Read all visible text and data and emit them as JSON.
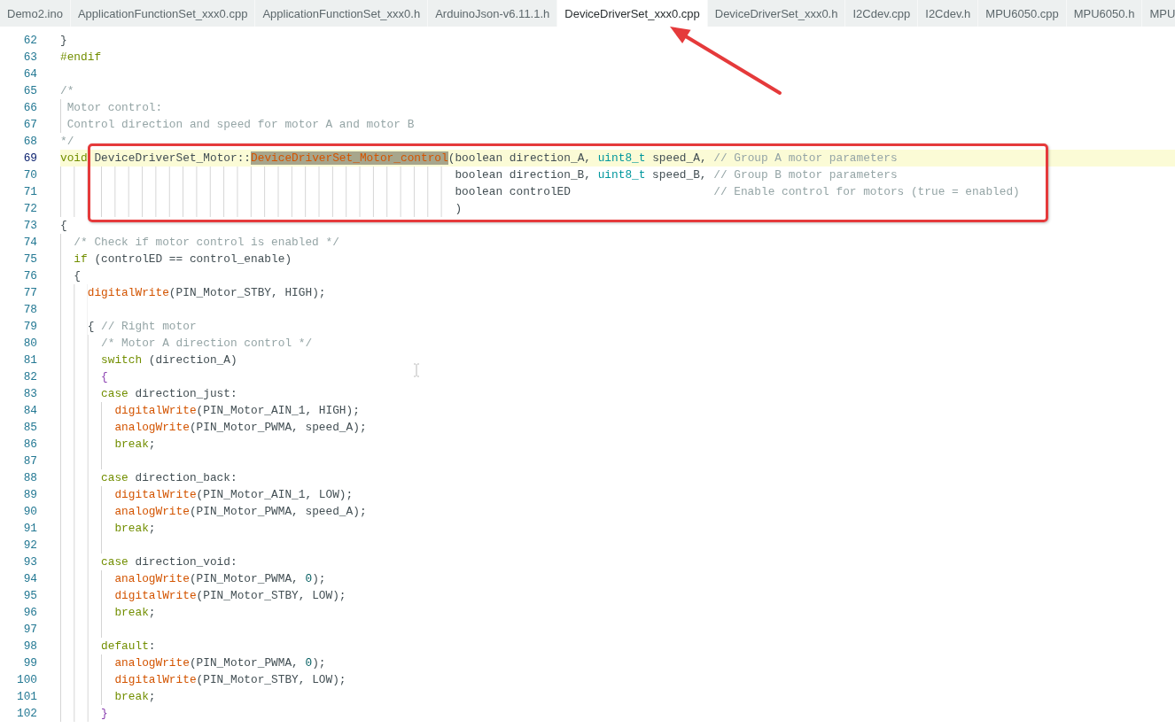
{
  "tabs": [
    {
      "label": "Demo2.ino",
      "selected": false
    },
    {
      "label": "ApplicationFunctionSet_xxx0.cpp",
      "selected": false
    },
    {
      "label": "ApplicationFunctionSet_xxx0.h",
      "selected": false
    },
    {
      "label": "ArduinoJson-v6.11.1.h",
      "selected": false
    },
    {
      "label": "DeviceDriverSet_xxx0.cpp",
      "selected": true
    },
    {
      "label": "DeviceDriverSet_xxx0.h",
      "selected": false
    },
    {
      "label": "I2Cdev.cpp",
      "selected": false
    },
    {
      "label": "I2Cdev.h",
      "selected": false
    },
    {
      "label": "MPU6050.cpp",
      "selected": false
    },
    {
      "label": "MPU6050.h",
      "selected": false
    },
    {
      "label": "MPU",
      "selected": false
    }
  ],
  "editor": {
    "lines": [
      {
        "number": "62",
        "current": false,
        "tokens": [
          {
            "kind": "plain",
            "text": "}"
          }
        ]
      },
      {
        "number": "63",
        "current": false,
        "tokens": [
          {
            "kind": "keyword",
            "text": "#endif"
          }
        ]
      },
      {
        "number": "64",
        "current": false
      },
      {
        "number": "65",
        "current": false,
        "tokens": [
          {
            "kind": "comment",
            "text": "/*"
          }
        ]
      },
      {
        "number": "66",
        "current": false,
        "tokens": [
          {
            "kind": "comment",
            "text": " Motor control:"
          }
        ]
      },
      {
        "number": "67",
        "current": false,
        "tokens": [
          {
            "kind": "comment",
            "text": " Control direction and speed for motor A and motor B"
          }
        ]
      },
      {
        "number": "68",
        "current": false,
        "tokens": [
          {
            "kind": "comment",
            "text": "*/"
          }
        ]
      },
      {
        "number": "69",
        "current": true,
        "tokens": [
          {
            "kind": "keyword",
            "text": "void"
          },
          {
            "kind": "plain",
            "text": " DeviceDriverSet_Motor::"
          },
          {
            "kind": "match",
            "text": "DeviceDriverSet_Motor_control"
          },
          {
            "kind": "plain",
            "text": "(boolean direction_A, "
          },
          {
            "kind": "type",
            "text": "uint8_t"
          },
          {
            "kind": "plain",
            "text": " speed_A, "
          },
          {
            "kind": "comment",
            "text": "// Group A motor parameters"
          }
        ]
      },
      {
        "number": "70",
        "current": false,
        "tokens": [
          {
            "kind": "plain",
            "text": "                                                          boolean direction_B, "
          },
          {
            "kind": "type",
            "text": "uint8_t"
          },
          {
            "kind": "plain",
            "text": " speed_B, "
          },
          {
            "kind": "comment",
            "text": "// Group B motor parameters"
          }
        ]
      },
      {
        "number": "71",
        "current": false,
        "tokens": [
          {
            "kind": "plain",
            "text": "                                                          boolean controlED                     "
          },
          {
            "kind": "comment",
            "text": "// Enable control for motors (true = enabled)"
          }
        ]
      },
      {
        "number": "72",
        "current": false,
        "tokens": [
          {
            "kind": "plain",
            "text": "                                                          )"
          }
        ]
      },
      {
        "number": "73",
        "current": false,
        "tokens": [
          {
            "kind": "plain",
            "text": "{"
          }
        ]
      },
      {
        "number": "74",
        "current": false,
        "tokens": [
          {
            "kind": "comment",
            "text": "  /* Check if motor control is enabled */"
          }
        ]
      },
      {
        "number": "75",
        "current": false,
        "tokens": [
          {
            "kind": "keyword",
            "text": "  if"
          },
          {
            "kind": "plain",
            "text": " (controlED == control_enable)"
          }
        ]
      },
      {
        "number": "76",
        "current": false,
        "tokens": [
          {
            "kind": "plain",
            "text": "  {"
          }
        ]
      },
      {
        "number": "77",
        "current": false,
        "tokens": [
          {
            "kind": "function",
            "text": "    digitalWrite"
          },
          {
            "kind": "plain",
            "text": "(PIN_Motor_STBY, HIGH);"
          }
        ]
      },
      {
        "number": "78",
        "current": false
      },
      {
        "number": "79",
        "current": false,
        "tokens": [
          {
            "kind": "plain",
            "text": "    { "
          },
          {
            "kind": "comment",
            "text": "// Right motor"
          }
        ]
      },
      {
        "number": "80",
        "current": false,
        "tokens": [
          {
            "kind": "comment",
            "text": "      /* Motor A direction control */"
          }
        ]
      },
      {
        "number": "81",
        "current": false,
        "tokens": [
          {
            "kind": "keyword",
            "text": "      switch"
          },
          {
            "kind": "plain",
            "text": " (direction_A)"
          }
        ]
      },
      {
        "number": "82",
        "current": false,
        "tokens": [
          {
            "kind": "bracket",
            "text": "      {"
          }
        ]
      },
      {
        "number": "83",
        "current": false,
        "tokens": [
          {
            "kind": "keyword",
            "text": "      case"
          },
          {
            "kind": "plain",
            "text": " direction_just:"
          }
        ]
      },
      {
        "number": "84",
        "current": false,
        "tokens": [
          {
            "kind": "function",
            "text": "        digitalWrite"
          },
          {
            "kind": "plain",
            "text": "(PIN_Motor_AIN_1, HIGH);"
          }
        ]
      },
      {
        "number": "85",
        "current": false,
        "tokens": [
          {
            "kind": "function",
            "text": "        analogWrite"
          },
          {
            "kind": "plain",
            "text": "(PIN_Motor_PWMA, speed_A);"
          }
        ]
      },
      {
        "number": "86",
        "current": false,
        "tokens": [
          {
            "kind": "keyword",
            "text": "        break"
          },
          {
            "kind": "plain",
            "text": ";"
          }
        ]
      },
      {
        "number": "87",
        "current": false
      },
      {
        "number": "88",
        "current": false,
        "tokens": [
          {
            "kind": "keyword",
            "text": "      case"
          },
          {
            "kind": "plain",
            "text": " direction_back:"
          }
        ]
      },
      {
        "number": "89",
        "current": false,
        "tokens": [
          {
            "kind": "function",
            "text": "        digitalWrite"
          },
          {
            "kind": "plain",
            "text": "(PIN_Motor_AIN_1, LOW);"
          }
        ]
      },
      {
        "number": "90",
        "current": false,
        "tokens": [
          {
            "kind": "function",
            "text": "        analogWrite"
          },
          {
            "kind": "plain",
            "text": "(PIN_Motor_PWMA, speed_A);"
          }
        ]
      },
      {
        "number": "91",
        "current": false,
        "tokens": [
          {
            "kind": "keyword",
            "text": "        break"
          },
          {
            "kind": "plain",
            "text": ";"
          }
        ]
      },
      {
        "number": "92",
        "current": false
      },
      {
        "number": "93",
        "current": false,
        "tokens": [
          {
            "kind": "keyword",
            "text": "      case"
          },
          {
            "kind": "plain",
            "text": " direction_void:"
          }
        ]
      },
      {
        "number": "94",
        "current": false,
        "tokens": [
          {
            "kind": "function",
            "text": "        analogWrite"
          },
          {
            "kind": "plain",
            "text": "(PIN_Motor_PWMA, "
          },
          {
            "kind": "number",
            "text": "0"
          },
          {
            "kind": "plain",
            "text": ");"
          }
        ]
      },
      {
        "number": "95",
        "current": false,
        "tokens": [
          {
            "kind": "function",
            "text": "        digitalWrite"
          },
          {
            "kind": "plain",
            "text": "(PIN_Motor_STBY, LOW);"
          }
        ]
      },
      {
        "number": "96",
        "current": false,
        "tokens": [
          {
            "kind": "keyword",
            "text": "        break"
          },
          {
            "kind": "plain",
            "text": ";"
          }
        ]
      },
      {
        "number": "97",
        "current": false
      },
      {
        "number": "98",
        "current": false,
        "tokens": [
          {
            "kind": "keyword",
            "text": "      default"
          },
          {
            "kind": "plain",
            "text": ":"
          }
        ]
      },
      {
        "number": "99",
        "current": false,
        "tokens": [
          {
            "kind": "function",
            "text": "        analogWrite"
          },
          {
            "kind": "plain",
            "text": "(PIN_Motor_PWMA, "
          },
          {
            "kind": "number",
            "text": "0"
          },
          {
            "kind": "plain",
            "text": ");"
          }
        ]
      },
      {
        "number": "100",
        "current": false,
        "tokens": [
          {
            "kind": "function",
            "text": "        digitalWrite"
          },
          {
            "kind": "plain",
            "text": "(PIN_Motor_STBY, LOW);"
          }
        ]
      },
      {
        "number": "101",
        "current": false,
        "tokens": [
          {
            "kind": "keyword",
            "text": "        break"
          },
          {
            "kind": "plain",
            "text": ";"
          }
        ]
      },
      {
        "number": "102",
        "current": false,
        "tokens": [
          {
            "kind": "bracket",
            "text": "      }"
          }
        ]
      }
    ]
  }
}
